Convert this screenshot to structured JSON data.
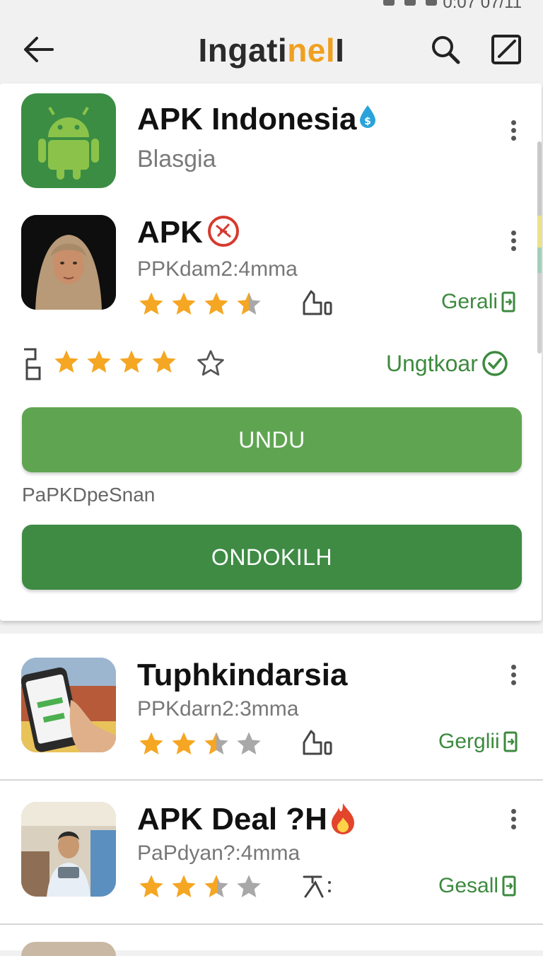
{
  "status_bar": {
    "time": "0:07 07/11"
  },
  "header": {
    "title_dark": "Ingati",
    "title_accent": "nel",
    "title_dark2": " ",
    "title_end": "I"
  },
  "featured": {
    "name": "APK Indonesia",
    "subtitle": "Blasgia"
  },
  "apps": [
    {
      "name": "APK",
      "meta": "PPKdam2:4mma",
      "rating": 3.5,
      "action": "Gerali"
    },
    {
      "name": "Tuphkindarsia",
      "meta": "PPKdarn2:3mma",
      "rating": 3.0,
      "action": "Gerglii"
    },
    {
      "name": "APK Deal ?H",
      "meta": "PaPdyan?:4mma",
      "rating": 3.0,
      "action": "Gesall"
    }
  ],
  "rating_bar": {
    "stars": 4,
    "label": "Ungtkoar"
  },
  "buttons": {
    "download": "UNDU",
    "section_label": "PaPKDpeSnan",
    "install": "ONDOKILH"
  },
  "colors": {
    "accent_green": "#3d8a3f",
    "button_light": "#5fa551",
    "button_dark": "#3f8b44",
    "star_gold": "#f5a623",
    "title_orange": "#f0a020"
  },
  "icons": [
    "back-arrow-icon",
    "search-icon",
    "edit-icon",
    "more-vert-icon",
    "star-icon",
    "size-icon",
    "download-icon",
    "check-circle-icon",
    "android-icon"
  ]
}
